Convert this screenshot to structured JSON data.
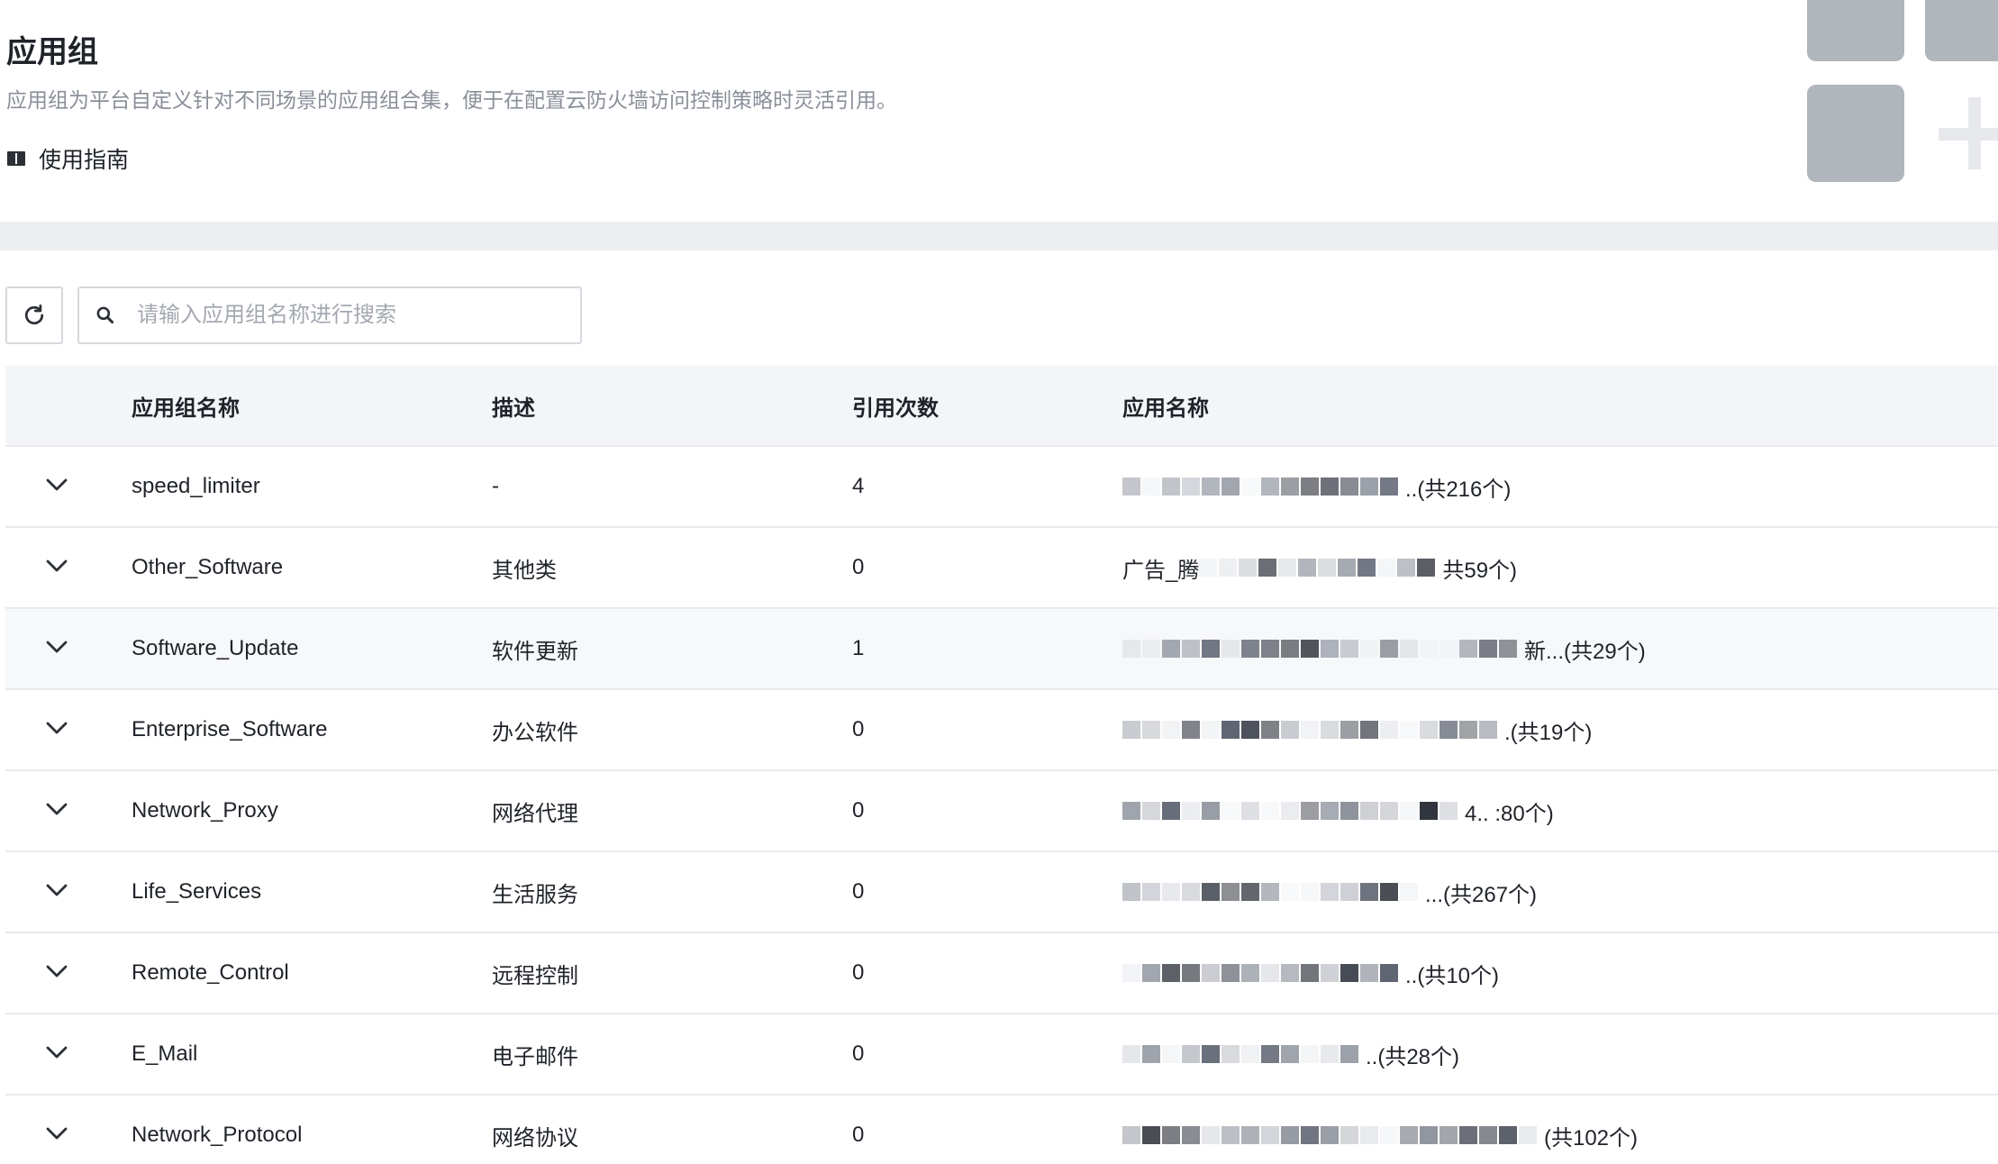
{
  "header": {
    "title": "应用组",
    "description": "应用组为平台自定义针对不同场景的应用组合集，便于在配置云防火墙访问控制策略时灵活引用。",
    "guide_label": "使用指南"
  },
  "toolbar": {
    "search_placeholder": "请输入应用组名称进行搜索"
  },
  "table": {
    "columns": [
      "应用组名称",
      "描述",
      "引用次数",
      "应用名称"
    ],
    "rows": [
      {
        "name": "speed_limiter",
        "desc": "-",
        "ref": "4",
        "apps_prefix": "",
        "apps_suffix": "..(共216个)"
      },
      {
        "name": "Other_Software",
        "desc": "其他类",
        "ref": "0",
        "apps_prefix": "广告_腾",
        "apps_suffix": "共59个)"
      },
      {
        "name": "Software_Update",
        "desc": "软件更新",
        "ref": "1",
        "apps_prefix": "",
        "apps_suffix": "新...(共29个)"
      },
      {
        "name": "Enterprise_Software",
        "desc": "办公软件",
        "ref": "0",
        "apps_prefix": "",
        "apps_suffix": ".(共19个)"
      },
      {
        "name": "Network_Proxy",
        "desc": "网络代理",
        "ref": "0",
        "apps_prefix": "",
        "apps_suffix": "4..   :80个)"
      },
      {
        "name": "Life_Services",
        "desc": "生活服务",
        "ref": "0",
        "apps_prefix": "",
        "apps_suffix": "...(共267个)"
      },
      {
        "name": "Remote_Control",
        "desc": "远程控制",
        "ref": "0",
        "apps_prefix": "",
        "apps_suffix": "..(共10个)"
      },
      {
        "name": "E_Mail",
        "desc": "电子邮件",
        "ref": "0",
        "apps_prefix": "",
        "apps_suffix": "..(共28个)"
      },
      {
        "name": "Network_Protocol",
        "desc": "网络协议",
        "ref": "0",
        "apps_prefix": "",
        "apps_suffix": "(共102个)"
      }
    ]
  },
  "icons": {
    "refresh": "refresh-icon",
    "search": "search-icon",
    "expand": "chevron-down-icon",
    "guide": "book-icon"
  }
}
